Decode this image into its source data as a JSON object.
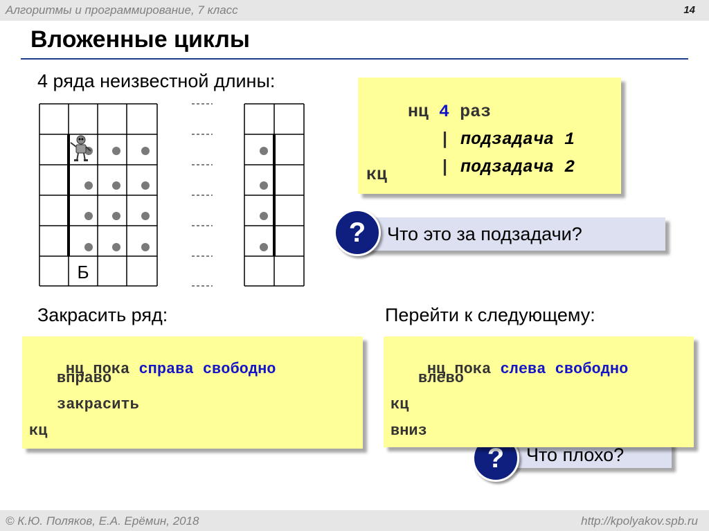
{
  "header": {
    "course": "Алгоритмы и программирование, 7 класс",
    "page_number": "14"
  },
  "slide": {
    "title": "Вложенные циклы"
  },
  "task": {
    "label": "4 ряда неизвестной длины:"
  },
  "grid": {
    "finish_label": "Б"
  },
  "main_code": {
    "line1": {
      "kw": "нц",
      "num": "4",
      "word": "раз"
    },
    "line2": {
      "bar": "|",
      "text": "подзадача 1"
    },
    "line3": {
      "bar": "|",
      "text": "подзадача 2"
    },
    "line4": "кц"
  },
  "question1": {
    "mark": "?",
    "text": "Что это за подзадачи?"
  },
  "paint_row": {
    "label": "Закрасить ряд:",
    "line1": {
      "kw": "нц пока",
      "cond": "справа свободно"
    },
    "line2": "вправо",
    "line3": "закрасить",
    "line4": "кц"
  },
  "next_row": {
    "label": "Перейти к следующему:",
    "line1": {
      "kw": "нц пока",
      "cond": "слева свободно"
    },
    "line2": "влево",
    "line3": "кц",
    "line4": "вниз"
  },
  "question2": {
    "mark": "?",
    "text": "Что плохо?"
  },
  "footer": {
    "authors": "© К.Ю. Поляков, Е.А. Ерёмин, 2018",
    "url": "http://kpolyakov.spb.ru"
  },
  "colors": {
    "title_rule": "#1f3c8c",
    "code_bg": "#ffff99",
    "question_bg": "#dde0f0",
    "question_circle": "#0f1f80",
    "keyword_blue": "#1515c8"
  },
  "icons": {
    "robot": "robot-icon",
    "question": "question-mark-icon"
  }
}
